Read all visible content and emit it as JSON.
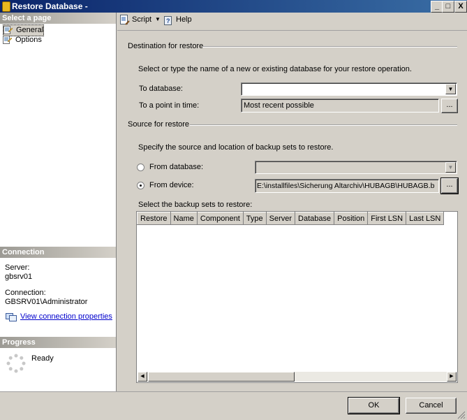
{
  "window": {
    "title": "Restore Database -",
    "minimize": "_",
    "maximize": "□",
    "close": "X"
  },
  "left": {
    "select_page_header": "Select a page",
    "pages": [
      {
        "label": "General",
        "icon": "page-icon"
      },
      {
        "label": "Options",
        "icon": "page-icon"
      }
    ],
    "connection_header": "Connection",
    "server_label": "Server:",
    "server_value": "gbsrv01",
    "connection_label": "Connection:",
    "connection_value": "GBSRV01\\Administrator",
    "view_connection_link": "View connection properties",
    "progress_header": "Progress",
    "progress_status": "Ready"
  },
  "toolbar": {
    "script_label": "Script",
    "help_label": "Help"
  },
  "destination": {
    "heading": "Destination for restore",
    "instructions": "Select or type the name of a new or existing database for your restore operation.",
    "to_database_label": "To database:",
    "to_database_value": "",
    "point_in_time_label": "To a point in time:",
    "point_in_time_value": "Most recent possible",
    "browse_label": "..."
  },
  "source": {
    "heading": "Source for restore",
    "instructions": "Specify the source and location of backup sets to restore.",
    "from_database_label": "From database:",
    "from_database_value": "",
    "from_device_label": "From device:",
    "from_device_value": "E:\\installfiles\\Sicherung Altarchiv\\HUBAGB\\HUBAGB.b",
    "device_browse_label": "...",
    "selected_option": "From device"
  },
  "backup_sets": {
    "label": "Select the backup sets to restore:",
    "columns": [
      "Restore",
      "Name",
      "Component",
      "Type",
      "Server",
      "Database",
      "Position",
      "First LSN",
      "Last LSN"
    ],
    "rows": []
  },
  "buttons": {
    "ok": "OK",
    "cancel": "Cancel"
  }
}
